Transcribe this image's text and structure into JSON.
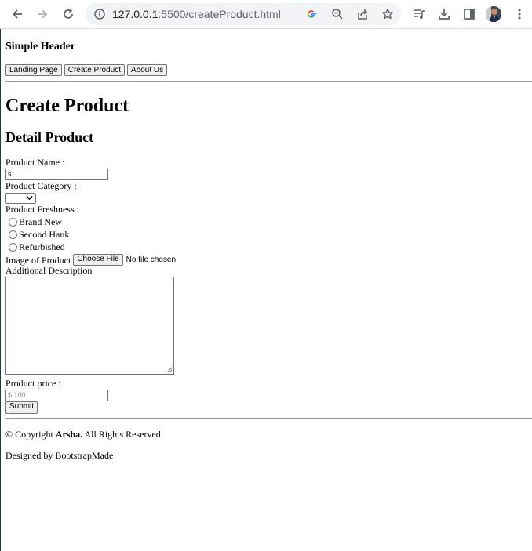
{
  "browser": {
    "url_host": "127.0.0.1",
    "url_rest": ":5500/createProduct.html",
    "icons": [
      "back-icon",
      "forward-icon",
      "reload-icon",
      "site-info-icon",
      "google-icon",
      "zoom-out-icon",
      "share-icon",
      "bookmark-star-icon",
      "media-queue-icon",
      "download-icon",
      "side-panel-icon",
      "profile-avatar",
      "more-menu-icon"
    ]
  },
  "header": {
    "title": "Simple Header",
    "nav": [
      "Landing Page",
      "Create Product",
      "About Us"
    ]
  },
  "main": {
    "title": "Create Product",
    "section_title": "Detail Product",
    "form": {
      "name_label": "Product Name :",
      "name_value": "s",
      "category_label": "Product Category :",
      "category_value": "",
      "freshness_label": "Product Freshness :",
      "freshness_options": [
        "Brand New",
        "Second Hank",
        "Refurbished"
      ],
      "image_label": "Image of Product",
      "file_button": "Choose File",
      "file_status": "No file chosen",
      "description_label": "Additional Description",
      "description_value": "",
      "price_label": "Product price :",
      "price_placeholder": "$ 100",
      "submit_label": "Submit"
    }
  },
  "footer": {
    "copyright_prefix": "© Copyright ",
    "copyright_brand": "Arsha.",
    "copyright_suffix": " All Rights Reserved",
    "credit": "Designed by BootstrapMade"
  },
  "colors": {
    "chrome_icon": "#5f6368",
    "omnibox_bg": "#f1f3f4",
    "control_border": "#767676",
    "control_bg": "#efefef"
  }
}
